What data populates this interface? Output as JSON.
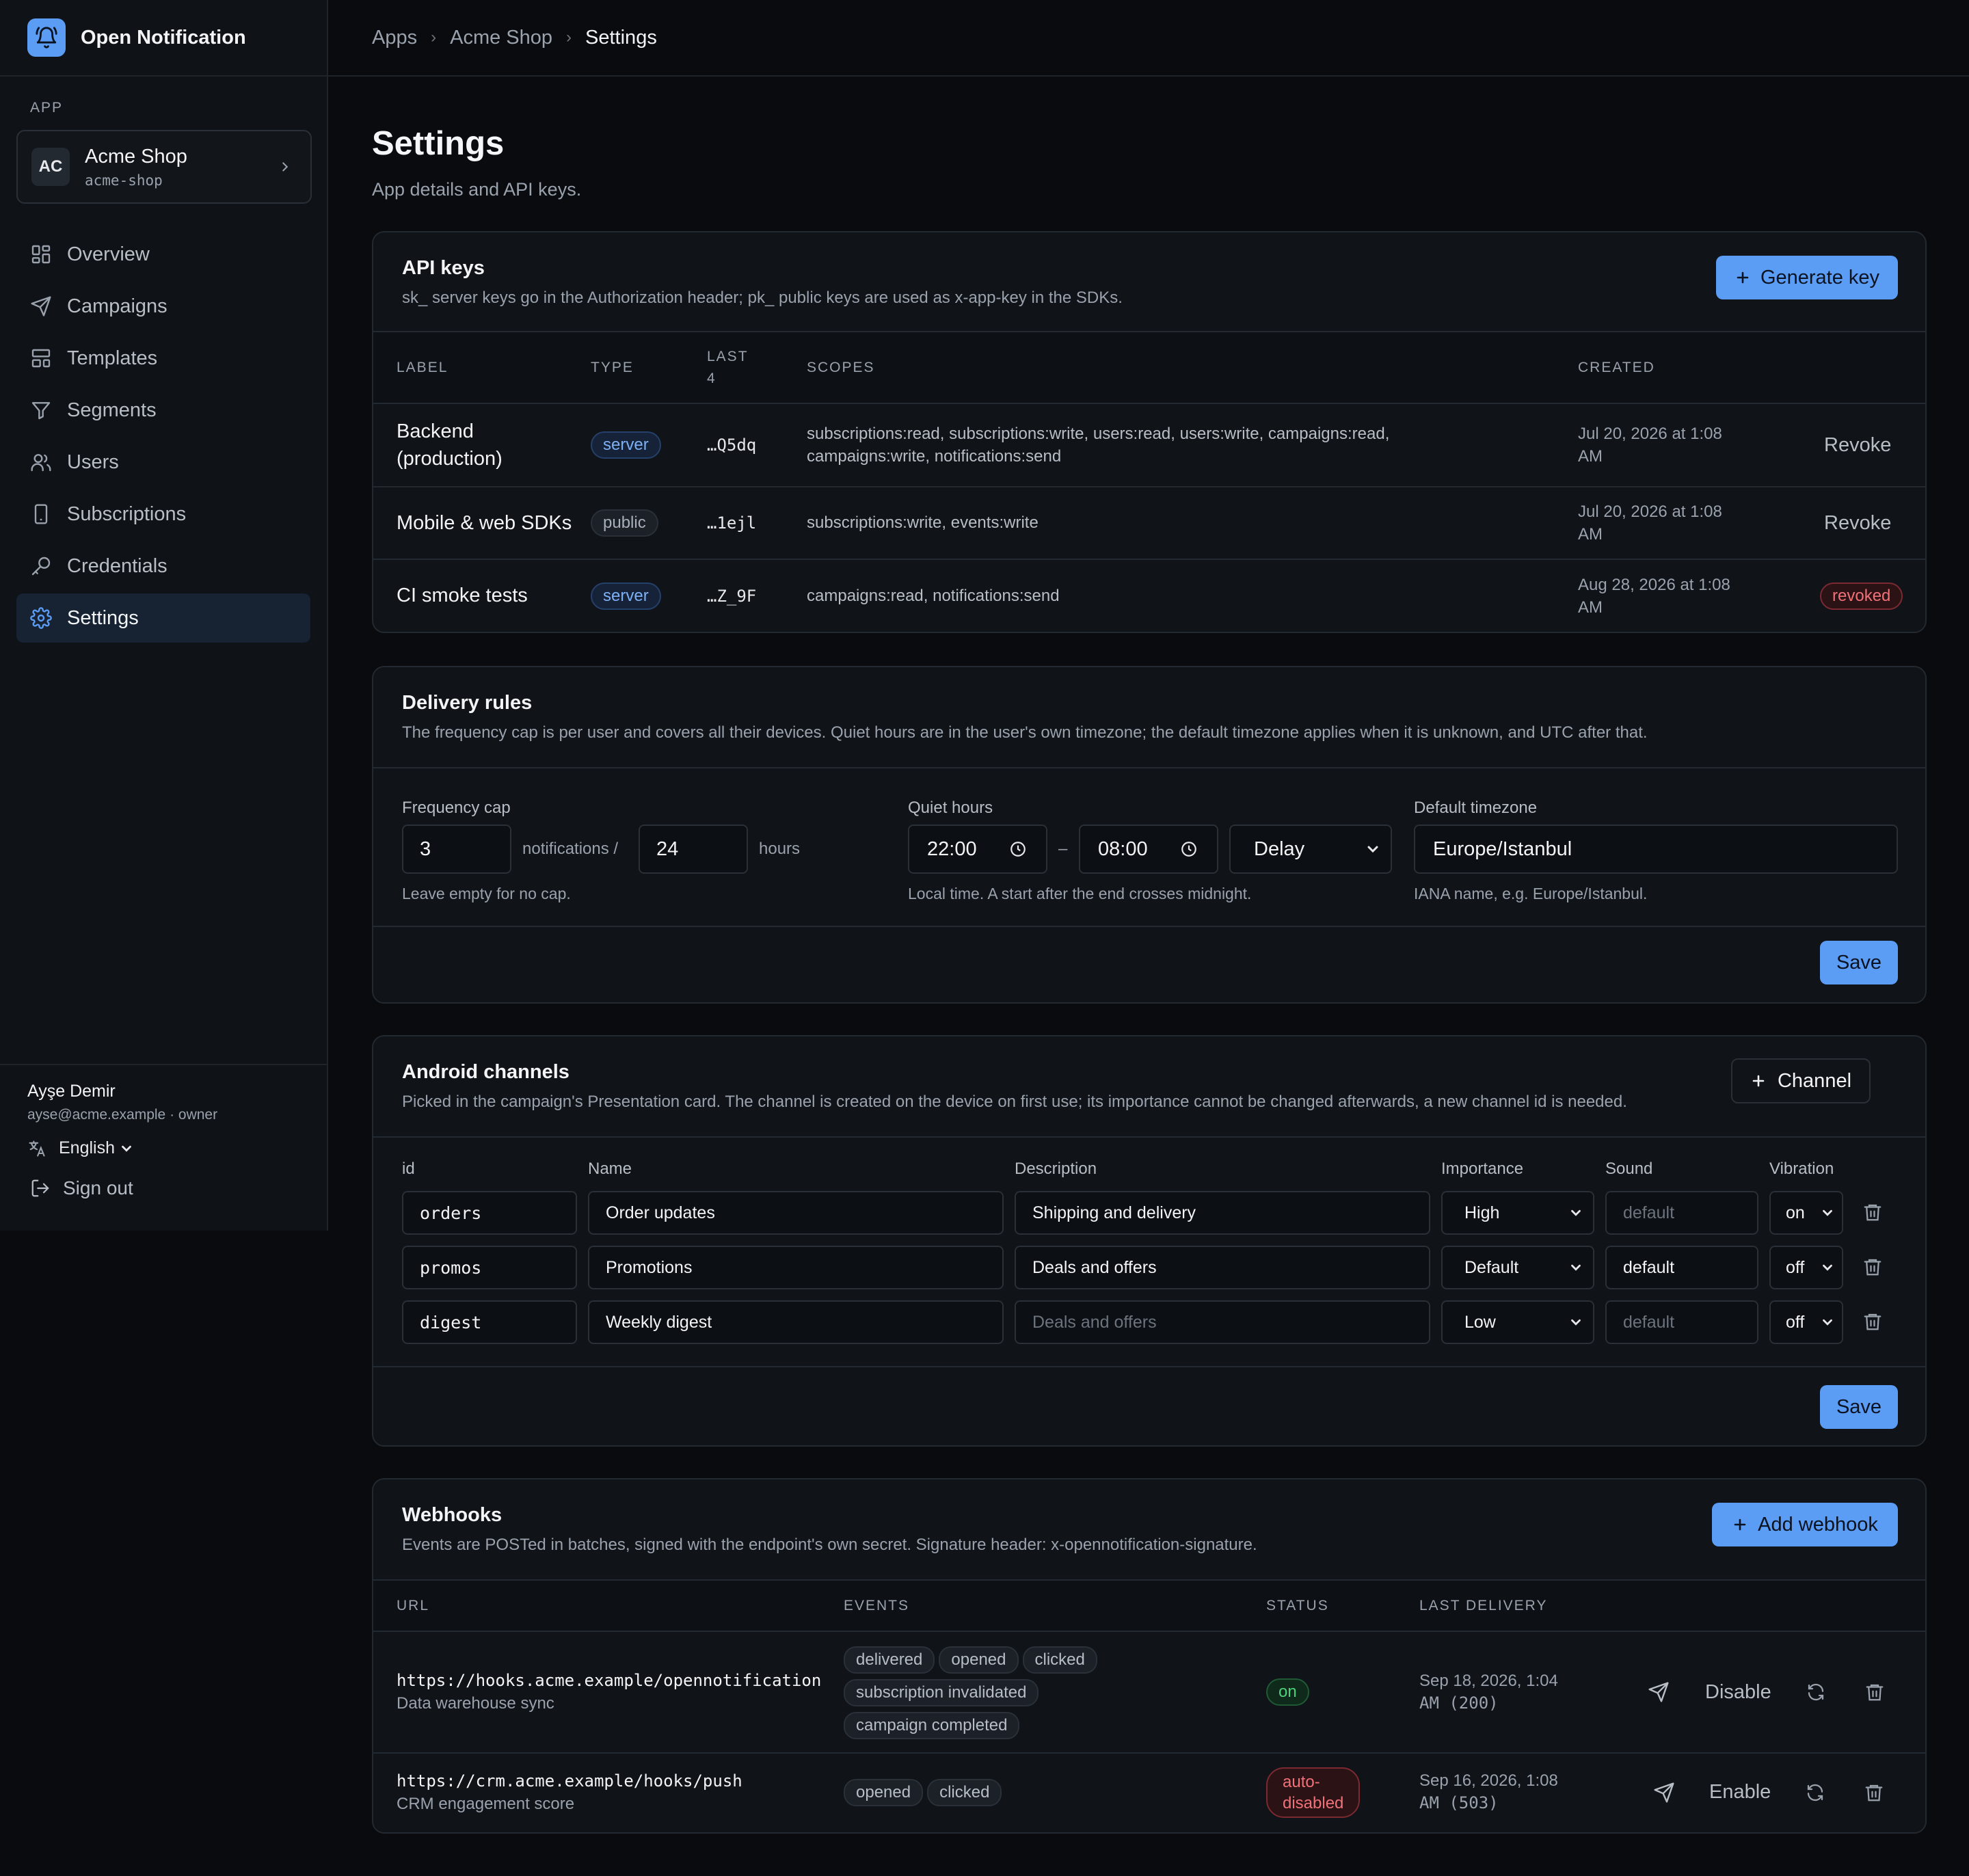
{
  "brand": {
    "name": "Open Notification",
    "icon": "bell-icon"
  },
  "sidebar": {
    "section_label": "APP",
    "app": {
      "avatar": "AC",
      "name": "Acme Shop",
      "slug": "acme-shop"
    },
    "nav": [
      {
        "label": "Overview",
        "icon": "grid-icon"
      },
      {
        "label": "Campaigns",
        "icon": "send-icon"
      },
      {
        "label": "Templates",
        "icon": "template-icon"
      },
      {
        "label": "Segments",
        "icon": "filter-icon"
      },
      {
        "label": "Users",
        "icon": "users-icon"
      },
      {
        "label": "Subscriptions",
        "icon": "phone-icon"
      },
      {
        "label": "Credentials",
        "icon": "key-icon"
      },
      {
        "label": "Settings",
        "icon": "gear-icon"
      }
    ],
    "active_nav": "Settings",
    "user": {
      "name": "Ayşe Demir",
      "email_role": "ayse@acme.example · owner"
    },
    "language": "English",
    "sign_out": "Sign out"
  },
  "breadcrumb": [
    "Apps",
    "Acme Shop",
    "Settings"
  ],
  "page": {
    "title": "Settings",
    "subtitle": "App details and API keys."
  },
  "api_keys": {
    "title": "API keys",
    "description": "sk_ server keys go in the Authorization header; pk_ public keys are used as x-app-key in the SDKs.",
    "generate_label": "Generate key",
    "columns": {
      "label": "LABEL",
      "type": "TYPE",
      "last4_line1": "LAST",
      "last4_line2": "4",
      "scopes": "SCOPES",
      "created": "CREATED"
    },
    "rows": [
      {
        "label_line1": "Backend",
        "label_line2": "(production)",
        "type": "server",
        "last4": "…Q5dq",
        "scopes_line1": "subscriptions:read, subscriptions:write, users:read, users:write, campaigns:read,",
        "scopes_line2": "campaigns:write, notifications:send",
        "created_line1": "Jul 20, 2026 at 1:08",
        "created_line2": "AM",
        "action": "Revoke"
      },
      {
        "label_line1": "Mobile & web SDKs",
        "label_line2": "",
        "type": "public",
        "last4": "…1ejl",
        "scopes_line1": "subscriptions:write, events:write",
        "scopes_line2": "",
        "created_line1": "Jul 20, 2026 at 1:08",
        "created_line2": "AM",
        "action": "Revoke"
      },
      {
        "label_line1": "CI smoke tests",
        "label_line2": "",
        "type": "server",
        "last4": "…Z_9F",
        "scopes_line1": "campaigns:read, notifications:send",
        "scopes_line2": "",
        "created_line1": "Aug 28, 2026 at 1:08",
        "created_line2": "AM",
        "status": "revoked"
      }
    ]
  },
  "delivery_rules": {
    "title": "Delivery rules",
    "description": "The frequency cap is per user and covers all their devices. Quiet hours are in the user's own timezone; the default timezone applies when it is unknown, and UTC after that.",
    "frequency_cap": {
      "label": "Frequency cap",
      "count": "3",
      "unit1": "notifications /",
      "window": "24",
      "unit2": "hours",
      "hint": "Leave empty for no cap."
    },
    "quiet_hours": {
      "label": "Quiet hours",
      "start": "22:00",
      "dash": "–",
      "end": "08:00",
      "mode": "Delay",
      "hint": "Local time. A start after the end crosses midnight."
    },
    "timezone": {
      "label": "Default timezone",
      "value": "Europe/Istanbul",
      "hint": "IANA name, e.g. Europe/Istanbul."
    },
    "save_label": "Save"
  },
  "android_channels": {
    "title": "Android channels",
    "description": "Picked in the campaign's Presentation card. The channel is created on the device on first use; its importance cannot be changed afterwards, a new channel id is needed.",
    "add_label": "Channel",
    "columns": {
      "id": "id",
      "name": "Name",
      "description": "Description",
      "importance": "Importance",
      "sound": "Sound",
      "vibration": "Vibration"
    },
    "rows": [
      {
        "id": "orders",
        "name": "Order updates",
        "description": "Shipping and delivery",
        "description_placeholder": false,
        "importance": "High",
        "sound": "default",
        "sound_placeholder": true,
        "vibration": "on"
      },
      {
        "id": "promos",
        "name": "Promotions",
        "description": "Deals and offers",
        "description_placeholder": false,
        "importance": "Default",
        "sound": "default",
        "sound_placeholder": false,
        "vibration": "off"
      },
      {
        "id": "digest",
        "name": "Weekly digest",
        "description": "Deals and offers",
        "description_placeholder": true,
        "importance": "Low",
        "sound": "default",
        "sound_placeholder": true,
        "vibration": "off"
      }
    ],
    "save_label": "Save"
  },
  "webhooks": {
    "title": "Webhooks",
    "description": "Events are POSTed in batches, signed with the endpoint's own secret. Signature header: x-opennotification-signature.",
    "add_label": "Add webhook",
    "columns": {
      "url": "URL",
      "events": "EVENTS",
      "status": "STATUS",
      "last_delivery": "LAST DELIVERY"
    },
    "rows": [
      {
        "url": "https://hooks.acme.example/opennotification",
        "name": "Data warehouse sync",
        "events": [
          "delivered",
          "opened",
          "clicked",
          "subscription invalidated",
          "campaign completed"
        ],
        "status": "on",
        "last_line1": "Sep 18, 2026, 1:04",
        "last_line2": "AM (200)",
        "toggle": "Disable"
      },
      {
        "url": "https://crm.acme.example/hooks/push",
        "name": "CRM engagement score",
        "events": [
          "opened",
          "clicked"
        ],
        "status_line1": "auto-",
        "status_line2": "disabled",
        "last_line1": "Sep 16, 2026, 1:08",
        "last_line2": "AM (503)",
        "toggle": "Enable"
      }
    ]
  },
  "colors": {
    "accent": "#5b9cf5",
    "background": "#090b0e",
    "danger": "#f07178",
    "success": "#4ed17a"
  }
}
